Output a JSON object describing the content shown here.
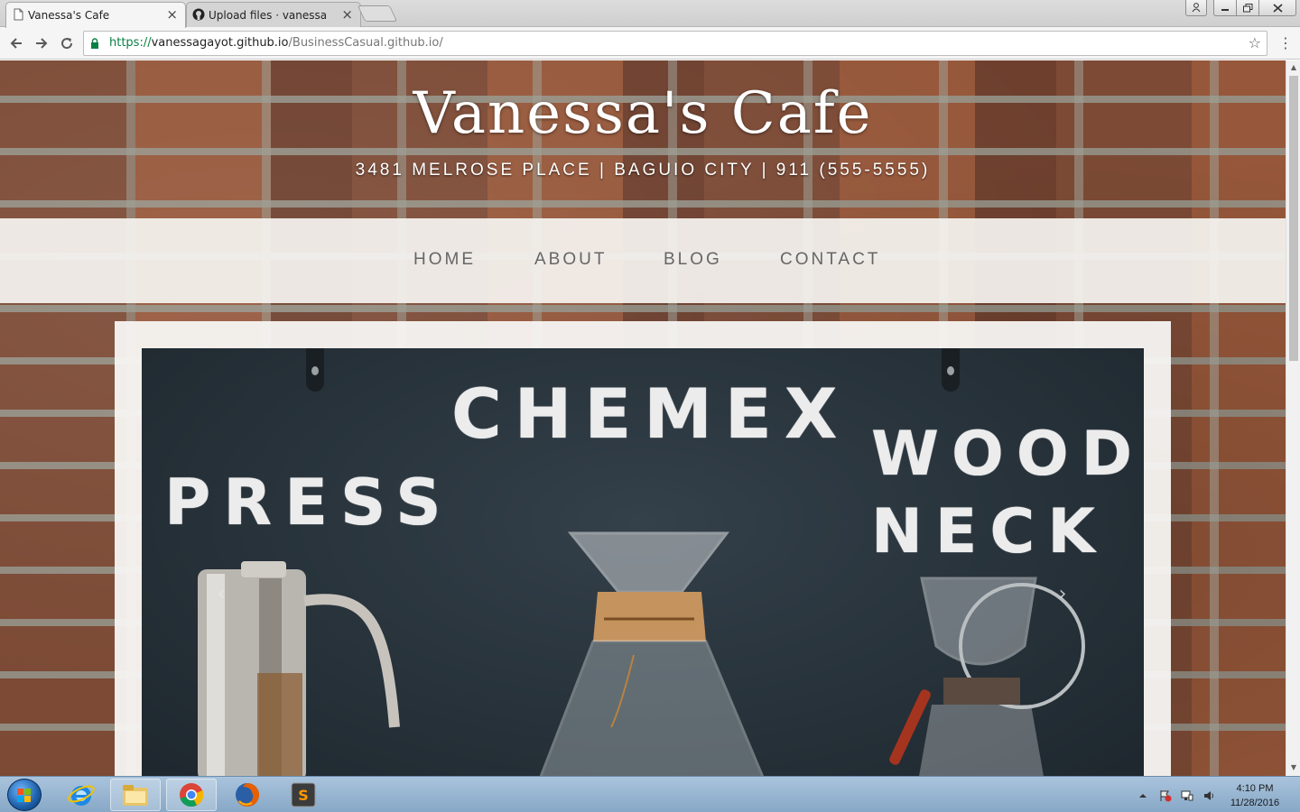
{
  "browser": {
    "tabs": [
      {
        "title": "Vanessa's Cafe",
        "active": true
      },
      {
        "title": "Upload files · vanessagayot",
        "active": false
      }
    ],
    "url": {
      "scheme": "https://",
      "host": "vanessagayot.github.io",
      "path": "/BusinessCasual.github.io/"
    }
  },
  "page": {
    "site_title": "Vanessa's Cafe",
    "address_line": "3481 MELROSE PLACE | BAGUIO CITY | 911 (555-5555)",
    "nav": [
      "HOME",
      "ABOUT",
      "BLOG",
      "CONTACT"
    ],
    "carousel": {
      "sign_words": [
        "CHEMEX",
        "PRESS",
        "WOOD",
        "NECK"
      ],
      "prev_arrow": "‹",
      "next_arrow": "›"
    }
  },
  "taskbar": {
    "pinned_apps": [
      "internet-explorer",
      "file-explorer",
      "chrome",
      "firefox",
      "sublime-text"
    ],
    "clock_time": "4:10 PM",
    "clock_date": "11/28/2016"
  },
  "colors": {
    "nav_text": "#666666",
    "url_scheme": "#0b8043",
    "board": "#27323a"
  }
}
